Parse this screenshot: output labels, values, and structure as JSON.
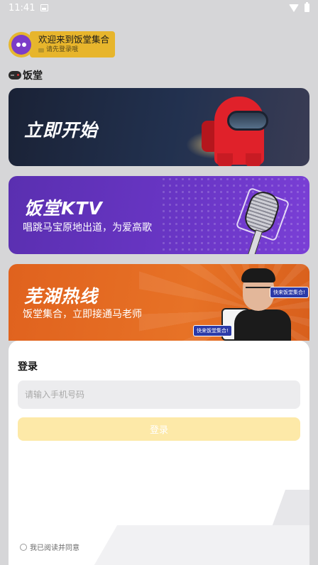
{
  "status_bar": {
    "time": "11:41",
    "icons": [
      "image-icon",
      "wifi-icon",
      "battery-icon"
    ]
  },
  "welcome": {
    "title": "欢迎来到饭堂集合",
    "subtitle": "请先登录哦"
  },
  "section": {
    "title": "饭堂",
    "icon": "gamepad-icon"
  },
  "banners": [
    {
      "title": "立即开始",
      "subtitle": "",
      "color": "#1e2a44"
    },
    {
      "title": "饭堂KTV",
      "subtitle": "唱跳马宝原地出道，为爱高歌",
      "color": "#6534c2"
    },
    {
      "title": "芜湖热线",
      "subtitle": "饭堂集合，立即接通马老师",
      "color": "#e26a22",
      "tag_1": "快来饭堂集合!",
      "tag_2": "快来饭堂集合!"
    }
  ],
  "login": {
    "title": "登录",
    "phone_placeholder": "请输入手机号码",
    "phone_value": "",
    "submit_label": "登录",
    "agree_label": "我已阅读并同意"
  },
  "colors": {
    "background": "#d6d6d8",
    "accent": "#e7b52c",
    "button_disabled": "#fde9a8"
  }
}
